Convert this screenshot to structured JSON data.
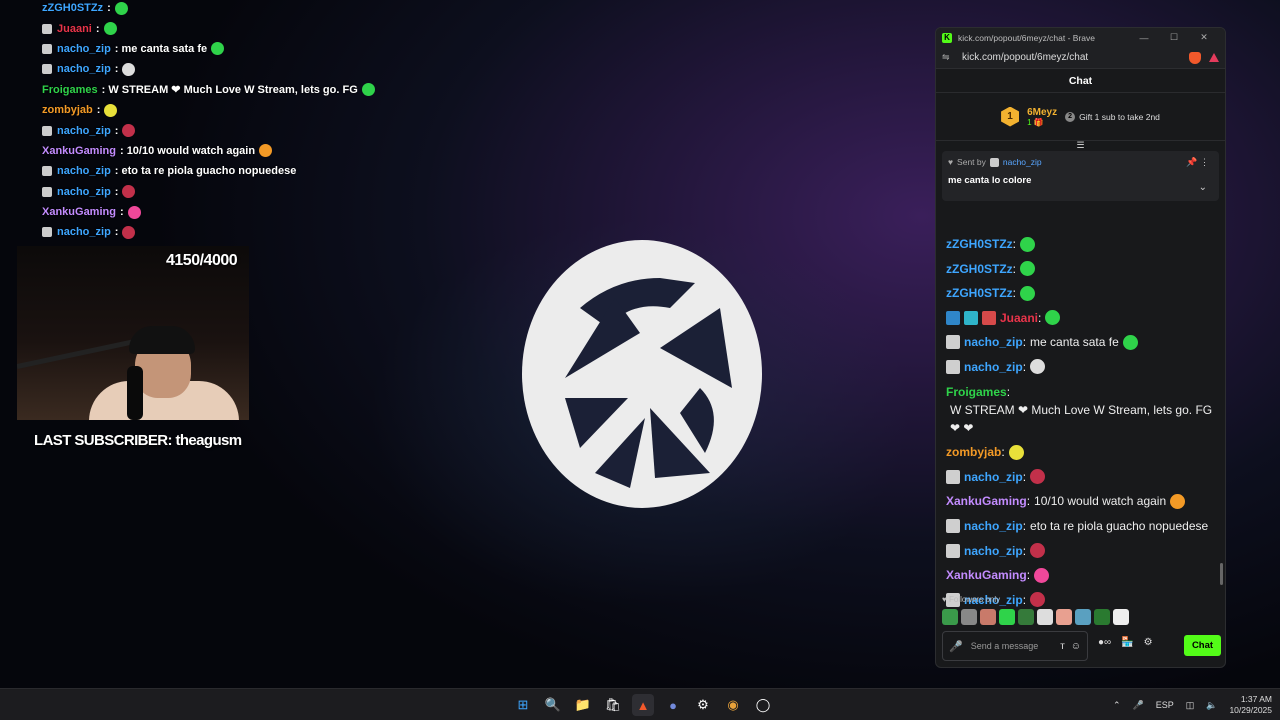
{
  "overlay": {
    "chat_lines": [
      {
        "user": "zZGH0STZz",
        "color": "#3ea6ff",
        "text": ":",
        "emote": "#2fd34a",
        "badge": false
      },
      {
        "user": "Juaani",
        "color": "#e8344a",
        "text": ":",
        "emote": "#2fd34a",
        "badge": true
      },
      {
        "user": "nacho_zip",
        "color": "#3ea6ff",
        "text": ": me canta sata fe",
        "emote": "#2fd34a",
        "badge": true
      },
      {
        "user": "nacho_zip",
        "color": "#3ea6ff",
        "text": ":",
        "emote": "#dddddd",
        "badge": true
      },
      {
        "user": "Froigames",
        "color": "#2fd34a",
        "text": ": W STREAM ❤ Much Love W Stream, lets go. FG",
        "emote": "#2fd34a",
        "badge": false
      },
      {
        "user": "zombyjab",
        "color": "#f39a26",
        "text": ":",
        "emote": "#e8e03a",
        "badge": false
      },
      {
        "user": "nacho_zip",
        "color": "#3ea6ff",
        "text": ":",
        "emote": "#c2304a",
        "badge": true
      },
      {
        "user": "XankuGaming",
        "color": "#c38cff",
        "text": ": 10/10 would watch again",
        "emote": "#f39a26",
        "badge": false
      },
      {
        "user": "nacho_zip",
        "color": "#3ea6ff",
        "text": ": eto ta re piola guacho nopuedese",
        "emote": "",
        "badge": true
      },
      {
        "user": "nacho_zip",
        "color": "#3ea6ff",
        "text": ":",
        "emote": "#c2304a",
        "badge": true
      },
      {
        "user": "XankuGaming",
        "color": "#c38cff",
        "text": ":",
        "emote": "#f0489a",
        "badge": false
      },
      {
        "user": "nacho_zip",
        "color": "#3ea6ff",
        "text": ":",
        "emote": "#c2304a",
        "badge": true
      }
    ],
    "sub_count": "4150/4000",
    "last_subscriber": "LAST SUBSCRIBER: theagusm"
  },
  "browser": {
    "title": "kick.com/popout/6meyz/chat - Brave",
    "url": "kick.com/popout/6meyz/chat"
  },
  "chat": {
    "header": "Chat",
    "top_gifter": {
      "rank": "1",
      "name": "6Meyz",
      "count": "1"
    },
    "gift_prompt": "Gift 1 sub to take 2nd",
    "gift_circle": "2",
    "pinned": {
      "sent_by_label": "Sent by",
      "sender": "nacho_zip",
      "message": "me canta lo colore"
    },
    "messages": [
      {
        "user": "zZGH0STZz",
        "color": "#3ea6ff",
        "text": "",
        "badges": [],
        "emote": "#2fd34a"
      },
      {
        "user": "zZGH0STZz",
        "color": "#3ea6ff",
        "text": "",
        "badges": [],
        "emote": "#2fd34a"
      },
      {
        "user": "zZGH0STZz",
        "color": "#3ea6ff",
        "text": "",
        "badges": [],
        "emote": "#2fd34a"
      },
      {
        "user": "Juaani",
        "color": "#e8344a",
        "text": "",
        "badges": [
          "blue",
          "teal",
          "red"
        ],
        "emote": "#2fd34a"
      },
      {
        "user": "nacho_zip",
        "color": "#3ea6ff",
        "text": "me canta sata fe",
        "badges": [
          "grey"
        ],
        "emote": "#2fd34a"
      },
      {
        "user": "nacho_zip",
        "color": "#3ea6ff",
        "text": "",
        "badges": [
          "grey"
        ],
        "emote": "#dddddd"
      },
      {
        "user": "Froigames",
        "color": "#2fd34a",
        "text": "W STREAM ❤ Much Love W Stream, lets go. FG ❤ ❤",
        "badges": [],
        "emote": ""
      },
      {
        "user": "zombyjab",
        "color": "#f39a26",
        "text": "",
        "badges": [],
        "emote": "#e8e03a"
      },
      {
        "user": "nacho_zip",
        "color": "#3ea6ff",
        "text": "",
        "badges": [
          "grey"
        ],
        "emote": "#c2304a"
      },
      {
        "user": "XankuGaming",
        "color": "#c38cff",
        "text": "10/10 would watch again",
        "badges": [],
        "emote": "#f39a26"
      },
      {
        "user": "nacho_zip",
        "color": "#3ea6ff",
        "text": "eto ta re piola guacho nopuedese",
        "badges": [
          "grey"
        ],
        "emote": ""
      },
      {
        "user": "nacho_zip",
        "color": "#3ea6ff",
        "text": "",
        "badges": [
          "grey"
        ],
        "emote": "#c2304a"
      },
      {
        "user": "XankuGaming",
        "color": "#c38cff",
        "text": "",
        "badges": [],
        "emote": "#f0489a"
      },
      {
        "user": "nacho_zip",
        "color": "#3ea6ff",
        "text": "",
        "badges": [
          "grey"
        ],
        "emote": "#c2304a"
      }
    ],
    "followers_only": "Followers only",
    "input_placeholder": "Send a message",
    "send_label": "Chat",
    "accent": "#53fc18"
  },
  "taskbar": {
    "language": "ESP",
    "time": "1:37 AM",
    "date": "10/29/2025"
  }
}
